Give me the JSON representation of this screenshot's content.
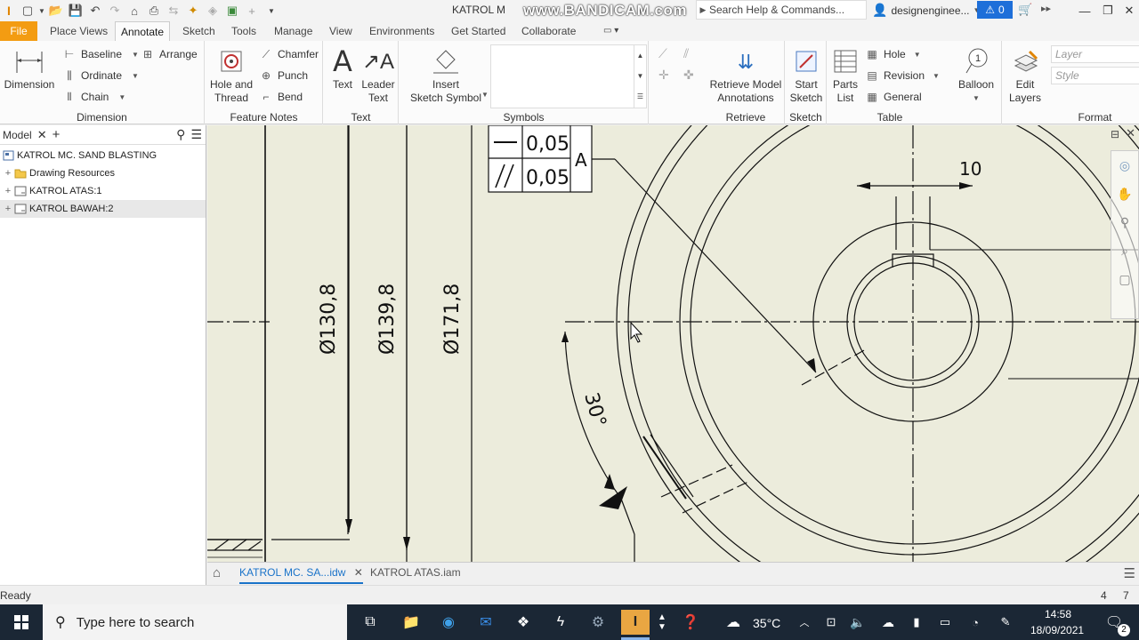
{
  "titlebar": {
    "doc_title": "KATROL M",
    "watermark": "www.BANDICAM.com",
    "search_placeholder": "Search Help & Commands...",
    "user": "designenginee...",
    "notification_count": "0"
  },
  "tabs": [
    "File",
    "Place Views",
    "Annotate",
    "Sketch",
    "Tools",
    "Manage",
    "View",
    "Environments",
    "Get Started",
    "Collaborate"
  ],
  "active_tab": "Annotate",
  "ribbon": {
    "dimension_panel": {
      "title": "Dimension",
      "dimension": "Dimension",
      "baseline": "Baseline",
      "ordinate": "Ordinate",
      "chain": "Chain",
      "arrange": "Arrange"
    },
    "feature_notes_panel": {
      "title": "Feature Notes",
      "hole_thread_1": "Hole and",
      "hole_thread_2": "Thread",
      "chamfer": "Chamfer",
      "punch": "Punch",
      "bend": "Bend"
    },
    "text_panel": {
      "title": "Text",
      "text": "Text",
      "leader_1": "Leader",
      "leader_2": "Text"
    },
    "symbols_panel": {
      "title": "Symbols",
      "insert_1": "Insert",
      "insert_2": "Sketch Symbol"
    },
    "retrieve_panel": {
      "title": "Retrieve",
      "retrieve_1": "Retrieve Model",
      "retrieve_2": "Annotations"
    },
    "sketch_panel": {
      "title": "Sketch",
      "start_1": "Start",
      "start_2": "Sketch"
    },
    "table_panel": {
      "title": "Table",
      "parts_1": "Parts",
      "parts_2": "List",
      "hole": "Hole",
      "revision": "Revision",
      "general": "General",
      "balloon": "Balloon"
    },
    "format_panel": {
      "title": "Format",
      "edit_1": "Edit",
      "edit_2": "Layers",
      "layer": "Layer",
      "style": "Style"
    }
  },
  "browser": {
    "tab": "Model",
    "items": [
      {
        "label": "KATROL MC. SAND BLASTING",
        "type": "drawing"
      },
      {
        "label": "Drawing Resources",
        "type": "folder"
      },
      {
        "label": "KATROL ATAS:1",
        "type": "sheet"
      },
      {
        "label": "KATROL BAWAH:2",
        "type": "sheet"
      }
    ]
  },
  "drawing": {
    "tol_1_value": "0,05",
    "tol_2_value": "0,05",
    "datum": "A",
    "dim_1": "Ø130,8",
    "dim_2": "Ø139,8",
    "dim_3": "Ø171,8",
    "dim_10": "10",
    "angle": "30°"
  },
  "doc_tabs": [
    {
      "label": "KATROL MC. SA...idw",
      "active": true
    },
    {
      "label": "KATROL ATAS.iam",
      "active": false
    }
  ],
  "status": {
    "text": "Ready",
    "num1": "4",
    "num2": "7"
  },
  "taskbar": {
    "search_placeholder": "Type here to search",
    "weather": "35°C",
    "time": "14:58",
    "date": "18/09/2021",
    "notif_count": "2"
  }
}
